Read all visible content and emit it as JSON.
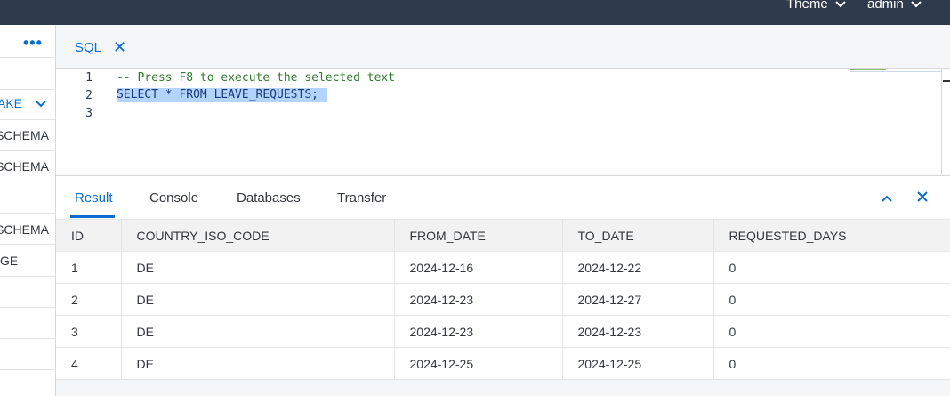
{
  "topbar": {
    "theme_label": "Theme",
    "user_label": "admin"
  },
  "left_panel": {
    "more_label": "•••",
    "items": [
      {
        "label": "AKE",
        "type": "dropdown"
      },
      {
        "label": "SCHEMA"
      },
      {
        "label": "SCHEMA"
      },
      {
        "label": ""
      },
      {
        "label": "SCHEMA"
      },
      {
        "label": "GE"
      }
    ]
  },
  "editor_tab": {
    "label": "SQL",
    "close_icon": "✕"
  },
  "editor": {
    "lines": [
      {
        "number": "1",
        "text": "-- Press F8 to execute the selected text"
      },
      {
        "number": "2",
        "text": "SELECT * FROM LEAVE_REQUESTS;"
      },
      {
        "number": "3",
        "text": ""
      }
    ]
  },
  "result_panel": {
    "tabs": [
      "Result",
      "Console",
      "Databases",
      "Transfer"
    ],
    "active_tab": "Result",
    "collapse_icon": "chevron-up-icon",
    "close_icon": "close-icon"
  },
  "results_table": {
    "columns": [
      "ID",
      "COUNTRY_ISO_CODE",
      "FROM_DATE",
      "TO_DATE",
      "REQUESTED_DAYS"
    ],
    "rows": [
      [
        "1",
        "DE",
        "2024-12-16",
        "2024-12-22",
        "0"
      ],
      [
        "2",
        "DE",
        "2024-12-23",
        "2024-12-27",
        "0"
      ],
      [
        "3",
        "DE",
        "2024-12-23",
        "2024-12-23",
        "0"
      ],
      [
        "4",
        "DE",
        "2024-12-25",
        "2024-12-25",
        "0"
      ]
    ]
  },
  "colors": {
    "shell": "#2f3b4c",
    "accent": "#0a6ed1",
    "selection": "#b3d4fc",
    "comment": "#2f7a2f"
  }
}
